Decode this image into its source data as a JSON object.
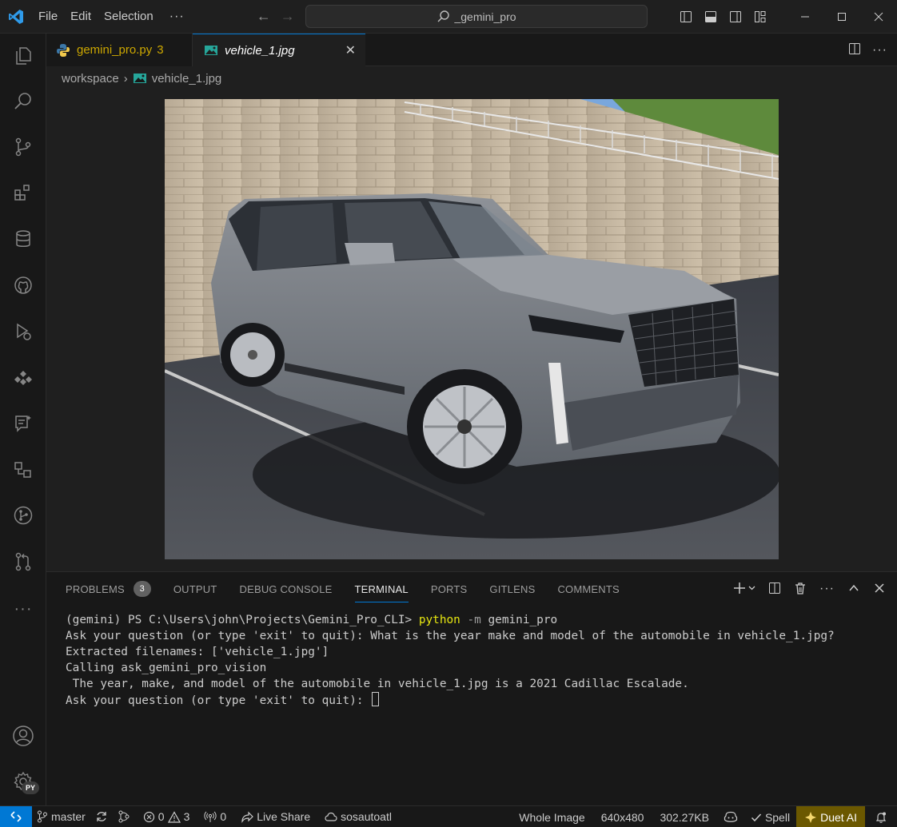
{
  "menu": {
    "file": "File",
    "edit": "Edit",
    "selection": "Selection",
    "more": "···"
  },
  "search": {
    "text": "_gemini_pro"
  },
  "tabs": {
    "py": {
      "label": "gemini_pro.py",
      "count": "3"
    },
    "jpg": {
      "label": "vehicle_1.jpg",
      "close": "✕"
    }
  },
  "breadcrumb": {
    "root": "workspace",
    "file": "vehicle_1.jpg"
  },
  "panel": {
    "tabs": [
      "PROBLEMS",
      "OUTPUT",
      "DEBUG CONSOLE",
      "TERMINAL",
      "PORTS",
      "GITLENS",
      "COMMENTS"
    ],
    "problems_count": "3",
    "active_tab": "TERMINAL"
  },
  "terminal": {
    "prompt": "(gemini) PS C:\\Users\\john\\Projects\\Gemini_Pro_CLI> ",
    "cmd": "python",
    "flag": " -m",
    "arg": " gemini_pro",
    "lines": [
      "Ask your question (or type 'exit' to quit): What is the year make and model of the automobile in vehicle_1.jpg?",
      "Extracted filenames: ['vehicle_1.jpg']",
      "Calling ask_gemini_pro_vision",
      " The year, make, and model of the automobile in vehicle_1.jpg is a 2021 Cadillac Escalade.",
      "Ask your question (or type 'exit' to quit): "
    ]
  },
  "status": {
    "branch": "master",
    "errors": "0",
    "warnings": "3",
    "ports": "0",
    "live_share": "Live Share",
    "account": "sosautoatl",
    "image_mode": "Whole Image",
    "dimensions": "640x480",
    "size": "302.27KB",
    "spell": "Spell",
    "duet": "Duet AI"
  },
  "activity_badge": "PY",
  "colors": {
    "accent": "#0078d4",
    "warning": "#cca700",
    "terminal_cmd": "#e5e510"
  }
}
